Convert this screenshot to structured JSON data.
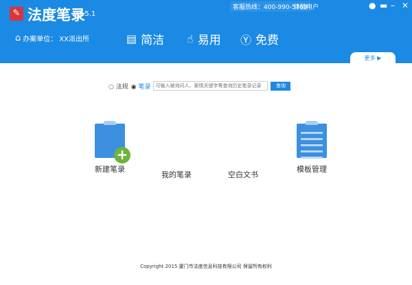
{
  "app": {
    "title": "法度笔录",
    "version": "V1.5.1",
    "hotline": "客服热线：400-990-5769",
    "user": "体验用户"
  },
  "unit": {
    "label": "办案单位：",
    "value": "XX派出所"
  },
  "features": [
    {
      "label": "简洁",
      "icon": "document-icon"
    },
    {
      "label": "易用",
      "icon": "hand-pointer-icon"
    },
    {
      "label": "免费",
      "icon": "yen-icon"
    }
  ],
  "more": "更多",
  "search": {
    "option1": "法规",
    "option2": "笔录",
    "selected": "笔录",
    "placeholder": "可输入被询问人、案情关键字等查询历史笔录记录",
    "button": "查询"
  },
  "tiles": [
    "新建笔录",
    "我的笔录",
    "空白文书",
    "模板管理"
  ],
  "footer": "Copyright 2015 厦门市法度信息科技有限公司 保留所有权利",
  "colors": {
    "primary": "#1b8ae4",
    "plus": "#6db33f"
  }
}
